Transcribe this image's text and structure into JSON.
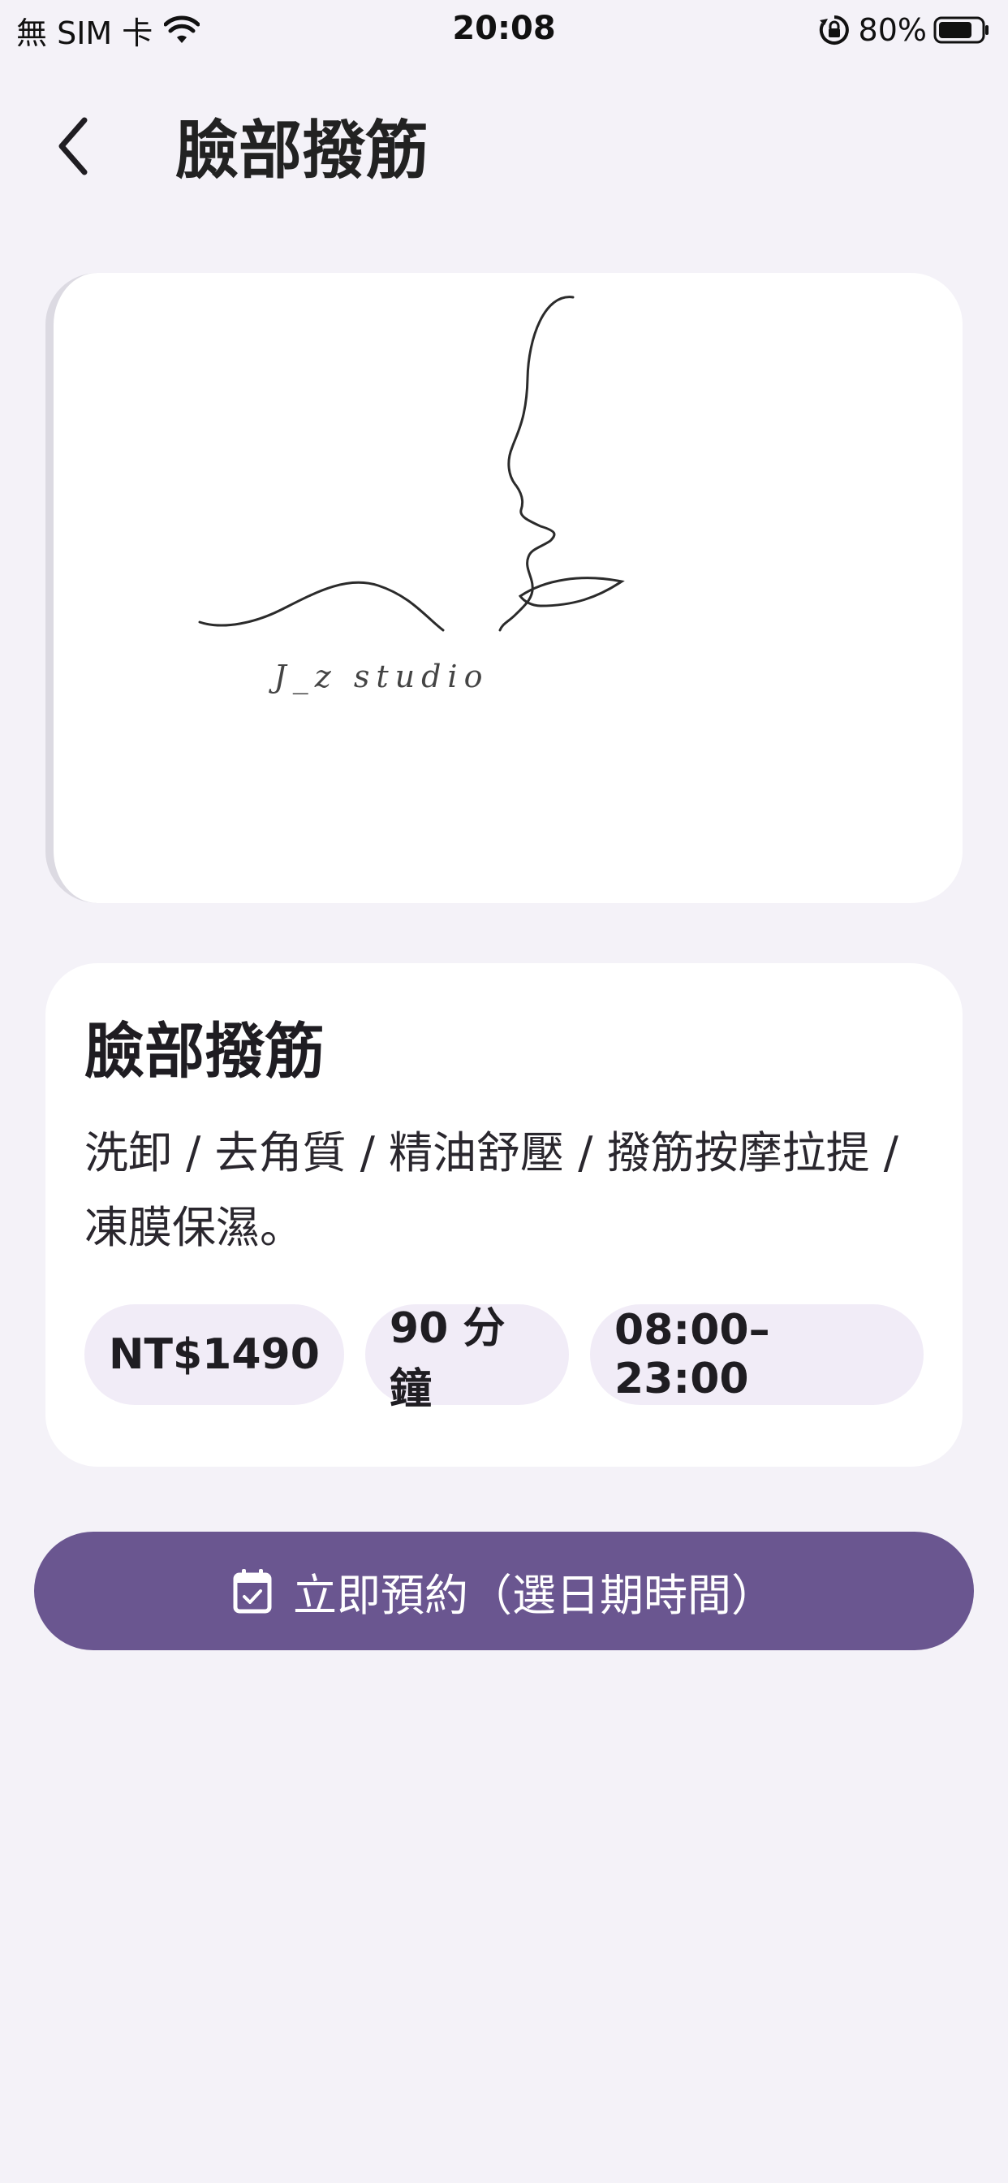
{
  "status_bar": {
    "carrier": "無 SIM 卡",
    "time": "20:08",
    "battery_percent": "80%",
    "battery_level": 0.8
  },
  "header": {
    "back_icon": "chevron-left-icon",
    "title": "臉部撥筋"
  },
  "hero": {
    "brand_text": "J_z studio"
  },
  "service": {
    "name": "臉部撥筋",
    "description": "洗卸 / 去角質 / 精油舒壓 / 撥筋按摩拉提 / 凍膜保濕。",
    "chips": [
      "NT$1490",
      "90 分鐘",
      "08:00–23:00"
    ]
  },
  "booking": {
    "icon": "calendar-check-icon",
    "label": "立即預約（選日期時間）"
  },
  "colors": {
    "background": "#f4f2f8",
    "card": "#ffffff",
    "chip": "#f1ecf7",
    "accent": "#6a5690"
  }
}
